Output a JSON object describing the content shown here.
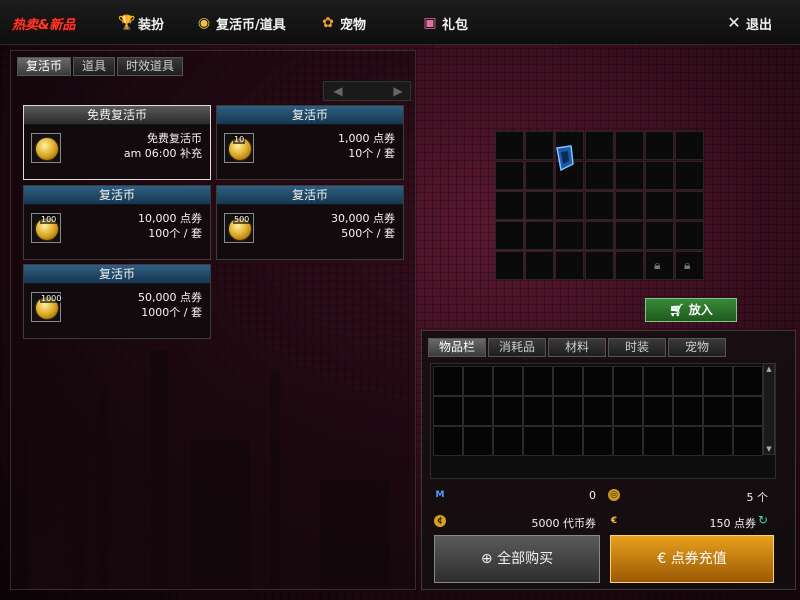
{
  "topbar": {
    "items": [
      {
        "label": "热卖&新品",
        "icon": "hot-new-icon"
      },
      {
        "label": "装扮",
        "icon": "trophy-icon"
      },
      {
        "label": "复活币/道具",
        "icon": "coin-icon"
      },
      {
        "label": "宠物",
        "icon": "paw-icon"
      },
      {
        "label": "礼包",
        "icon": "gift-icon"
      }
    ],
    "exit_label": "退出"
  },
  "left": {
    "tabs": [
      "复活币",
      "道具",
      "时效道具"
    ],
    "active_tab": 0,
    "cards": [
      {
        "header": "免费复活币",
        "name": "免费复活币",
        "line2": "am 06:00 补充",
        "coin_num": "",
        "free": true,
        "selected": true
      },
      {
        "header": "复活币",
        "line1": "1,000 点券",
        "line2": "10个 / 套",
        "coin_num": "10"
      },
      {
        "header": "复活币",
        "line1": "10,000 点券",
        "line2": "100个 / 套",
        "coin_num": "100"
      },
      {
        "header": "复活币",
        "line1": "30,000 点券",
        "line2": "500个 / 套",
        "coin_num": "500"
      },
      {
        "header": "复活币",
        "line1": "50,000 点券",
        "line2": "1000个 / 套",
        "coin_num": "1000"
      }
    ]
  },
  "preview": {
    "put_label": "放入"
  },
  "inventory": {
    "tabs": [
      "物品栏",
      "消耗品",
      "材料",
      "时装",
      "宠物"
    ],
    "active_tab": 0
  },
  "currency": {
    "m_points": "0",
    "coins": "5 个",
    "vouchers": "5000 代币券",
    "cash": "150 点券"
  },
  "buttons": {
    "buy_all": "全部购买",
    "recharge": "点券充值"
  },
  "colors": {
    "hot": "#ff3a2a",
    "card_header": "#2f5f82",
    "put_button": "#3a8a3a",
    "recharge": "#e8a01c"
  }
}
